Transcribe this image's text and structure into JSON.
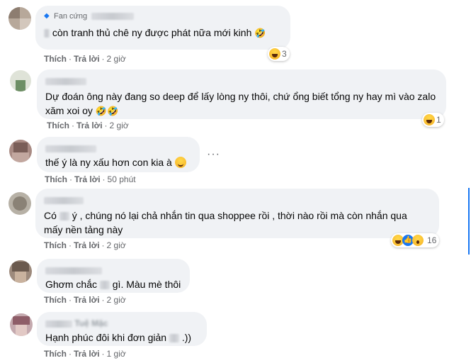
{
  "comments": [
    {
      "badge": "Fan cứng",
      "text_before": "",
      "text": "còn tranh thủ chê ny được phát nữa mới kinh",
      "emoji": "🤣",
      "like": "Thích",
      "reply": "Trả lời",
      "time": "2 giờ",
      "reaction_count": "3"
    },
    {
      "text": "Dự đoán ông này đang so deep để lấy lòng ny thôi, chứ ổng biết tổng ny hay mì vào zalo xăm xoi oy",
      "emoji": "🤣🤣",
      "like": "Thích",
      "reply": "Trả lời",
      "time": "2 giờ",
      "reaction_count": "1"
    },
    {
      "text": "thế ý là ny xấu hơn con kia à",
      "like": "Thích",
      "reply": "Trả lời",
      "time": "50 phút",
      "more": "···"
    },
    {
      "text_a": "Có",
      "text_b": "ý , chúng nó lại chả nhắn tin qua shoppee rồi , thời nào rồi mà còn nhắn qua",
      "text_line2": "mấy nền tảng này",
      "like": "Thích",
      "reply": "Trả lời",
      "time": "2 giờ",
      "reaction_count": "16"
    },
    {
      "text_a": "Ghơm chắc",
      "text_b": "gì. Màu mè thôi",
      "like": "Thích",
      "reply": "Trả lời",
      "time": "2 giờ"
    },
    {
      "name_partial": "Tuệ Mặc",
      "text_a": "Hạnh phúc đôi khi đơn giản",
      "text_b": ".))",
      "like": "Thích",
      "reply": "Trả lời",
      "time": "1 giờ"
    }
  ],
  "colors": {
    "bubble": "#f0f2f5",
    "accent": "#1877f2",
    "meta": "#65676b"
  }
}
